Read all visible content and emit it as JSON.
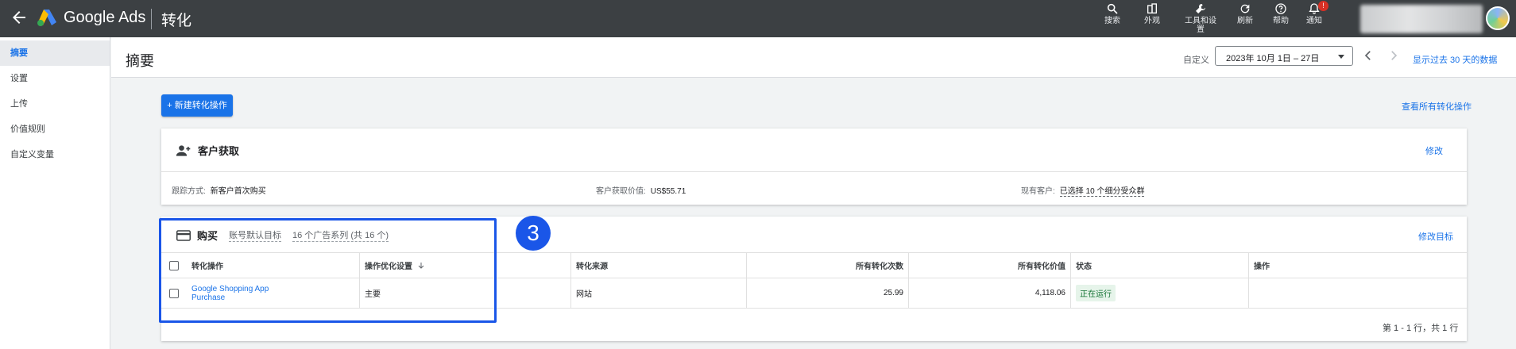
{
  "topbar": {
    "brand": "Google Ads",
    "title": "转化",
    "tools": [
      {
        "label": "搜索",
        "icon": "search-icon"
      },
      {
        "label": "外观",
        "icon": "appearance-icon"
      },
      {
        "label": "工具和设置",
        "icon": "wrench-icon"
      },
      {
        "label": "刷新",
        "icon": "refresh-icon"
      },
      {
        "label": "帮助",
        "icon": "help-icon"
      },
      {
        "label": "通知",
        "icon": "bell-icon",
        "badge": "!"
      }
    ]
  },
  "sidebar": {
    "items": [
      {
        "label": "摘要",
        "active": true
      },
      {
        "label": "设置"
      },
      {
        "label": "上传"
      },
      {
        "label": "价值规则"
      },
      {
        "label": "自定义变量"
      }
    ]
  },
  "header": {
    "page_title": "摘要",
    "date_label": "自定义",
    "date_range": "2023年 10月 1日 – 27日",
    "show_30_days": "显示过去 30 天的数据"
  },
  "actions": {
    "new_conversion": "+ 新建转化操作",
    "view_all": "查看所有转化操作"
  },
  "acquisition_card": {
    "title": "客户获取",
    "edit": "修改",
    "tracking_label": "跟踪方式:",
    "tracking_value": "新客户首次购买",
    "value_label": "客户获取价值:",
    "value_value": "US$55.71",
    "existing_label": "现有客户:",
    "existing_value": "已选择 10 个细分受众群"
  },
  "purchase_card": {
    "title": "购买",
    "account_default": "账号默认目标",
    "campaigns": "16 个广告系列 (共 16 个)",
    "edit_goal": "修改目标",
    "columns": [
      "转化操作",
      "操作优化设置",
      "转化来源",
      "所有转化次数",
      "所有转化价值",
      "状态",
      "操作"
    ],
    "rows": [
      {
        "action": "Google Shopping App Purchase",
        "optimization": "主要",
        "source": "网站",
        "all_conversions": "25.99",
        "all_value": "4,118.06",
        "status": "正在运行",
        "operation": ""
      }
    ],
    "pager": "第 1 - 1 行，共 1 行"
  },
  "annotation": {
    "step": "3"
  },
  "colors": {
    "accent": "#1a73e8",
    "topbar": "#3c4043",
    "annotation": "#1a56e8"
  }
}
